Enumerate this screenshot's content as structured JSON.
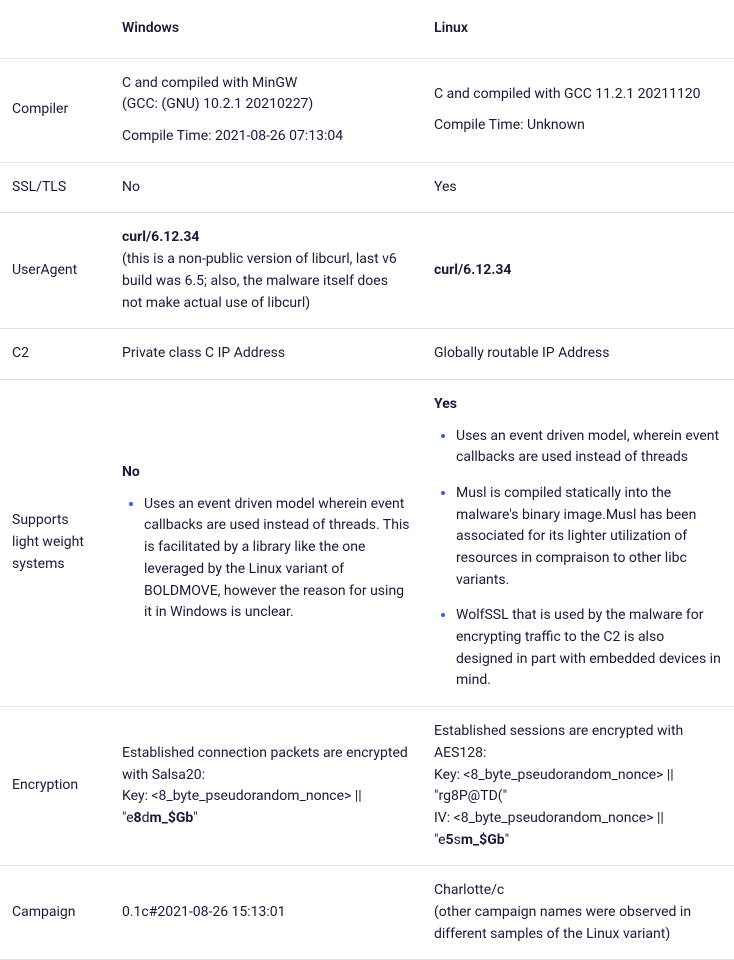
{
  "headers": {
    "blank": "",
    "windows": "Windows",
    "linux": "Linux"
  },
  "rows": {
    "compiler": {
      "label": "Compiler",
      "win_line1": "C and compiled with MinGW",
      "win_line2": "(GCC: (GNU) 10.2.1 20210227)",
      "win_line3": "Compile Time: 2021-08-26 07:13:04",
      "lin_line1": "C and compiled with GCC 11.2.1 20211120",
      "lin_line2": "Compile Time: Unknown"
    },
    "ssl": {
      "label": "SSL/TLS",
      "win": "No",
      "lin": "Yes"
    },
    "useragent": {
      "label": "UserAgent",
      "win_bold": "curl/6.12.34",
      "win_note": "(this is a non-public version of libcurl, last v6 build was 6.5; also, the malware itself does not make actual use of libcurl)",
      "lin_bold": "curl/6.12.34"
    },
    "c2": {
      "label": "C2",
      "win": "Private class C IP Address",
      "lin": "Globally routable IP Address"
    },
    "lightweight": {
      "label": "Supports light weight systems",
      "win_bold": "No",
      "win_bullet1": " Uses an event driven model wherein event callbacks are used instead of threads. This is facilitated by a library like the one leveraged by the Linux variant of BOLDMOVE, however the reason for using it in Windows is unclear.",
      "lin_bold": "Yes",
      "lin_bullet1": "Uses an event driven model, wherein event callbacks are used instead of threads",
      "lin_bullet2": "Musl is compiled statically into the malware's binary image.Musl has been associated for its lighter utilization of resources in compraison to other libc variants.",
      "lin_bullet3": "WolfSSL that is used by the malware for encrypting traffic to the C2 is also designed in part with embedded devices in mind."
    },
    "encryption": {
      "label": "Encryption",
      "win_line1": "Established connection packets are encrypted with Salsa20:",
      "win_line2a": "Key: <8_byte_pseudorandom_nonce> || \"",
      "win_line2b_plain1": "e",
      "win_line2b_bold1": "8",
      "win_line2b_plain2": "d",
      "win_line2b_bold2": "m_$Gb",
      "win_line2c": "\"",
      "lin_line1": "Established sessions are encrypted with AES128:",
      "lin_line2": "Key: <8_byte_pseudorandom_nonce> || \"rg8P@TD(\"",
      "lin_line3a": "IV: <8_byte_pseudorandom_nonce> || \"",
      "lin_line3b_plain1": "e",
      "lin_line3b_bold1": "5",
      "lin_line3b_plain2": "s",
      "lin_line3b_bold2": "m_$Gb",
      "lin_line3c": "\""
    },
    "campaign": {
      "label": "Campaign",
      "win": "0.1c#2021-08-26 15:13:01",
      "lin_line1": "Charlotte/c",
      "lin_line2": "(other campaign names were observed in different samples of the Linux variant)"
    }
  }
}
